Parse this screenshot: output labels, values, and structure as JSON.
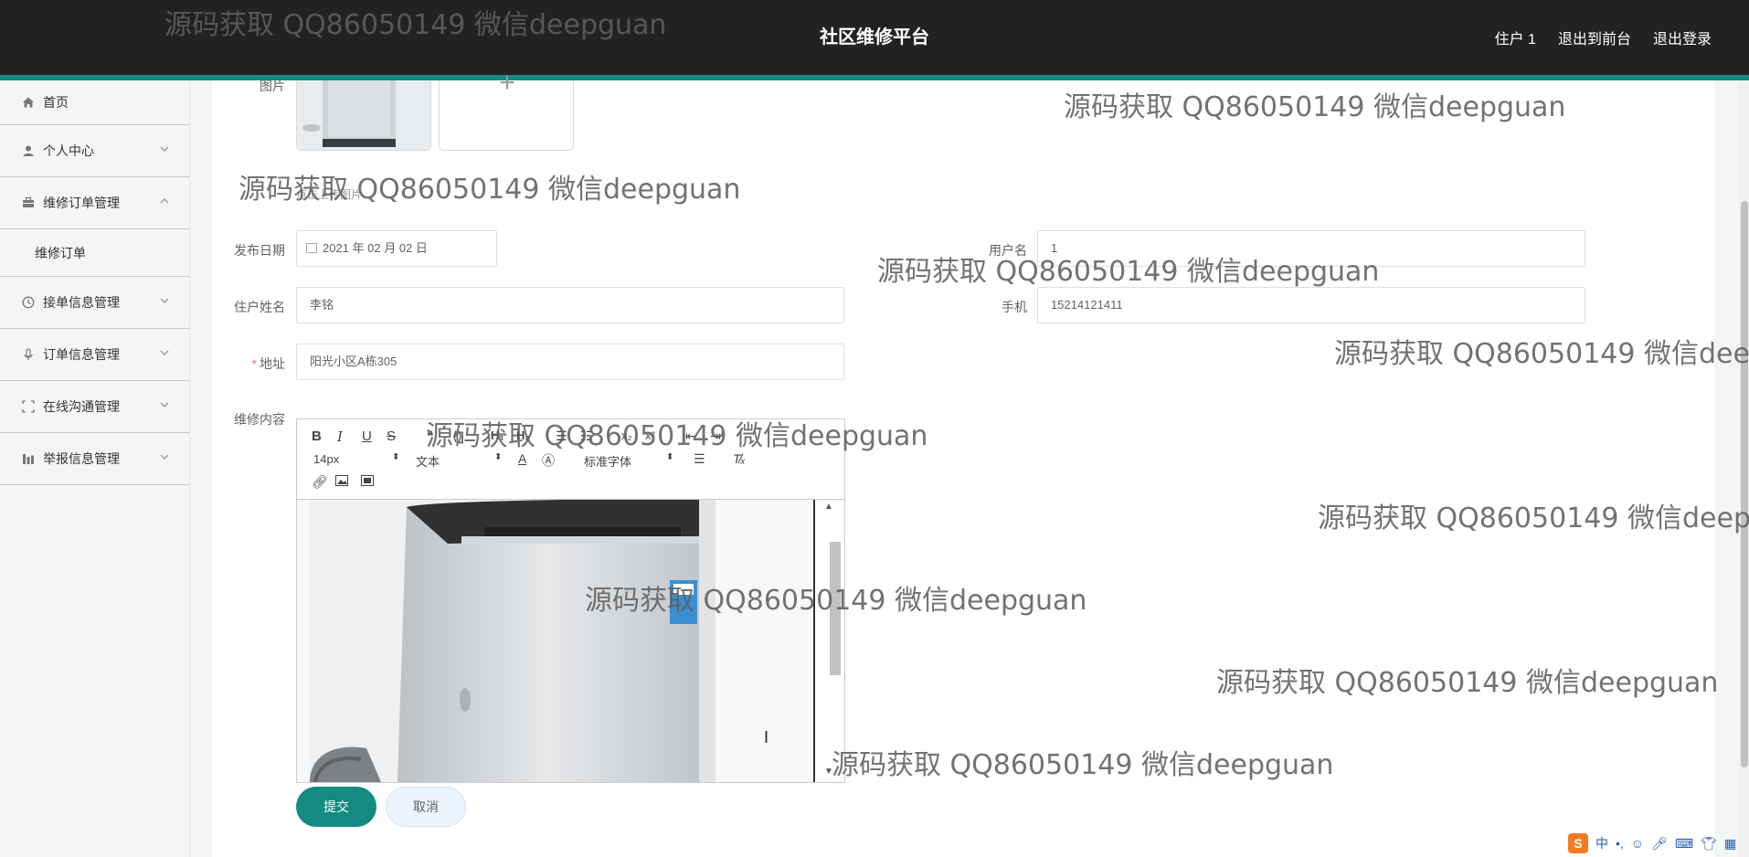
{
  "header": {
    "title": "社区维修平台",
    "user": "住户 1",
    "front_link": "退出到前台",
    "logout_link": "退出登录"
  },
  "sidebar": {
    "items": [
      {
        "label": "首页",
        "icon": "home-icon"
      },
      {
        "label": "个人中心",
        "icon": "user-icon"
      },
      {
        "label": "维修订单管理",
        "icon": "briefcase-icon"
      },
      {
        "label": "维修订单"
      },
      {
        "label": "接单信息管理",
        "icon": "clock-icon"
      },
      {
        "label": "订单信息管理",
        "icon": "microphone-icon"
      },
      {
        "label": "在线沟通管理",
        "icon": "fullscreen-icon"
      },
      {
        "label": "举报信息管理",
        "icon": "chart-icon"
      }
    ]
  },
  "form": {
    "image_label": "图片",
    "upload_tip": "点击上传图片",
    "date_label": "发布日期",
    "date_value": "2021 年 02 月 02 日",
    "username_label": "用户名",
    "username_value": "1",
    "resident_label": "住户姓名",
    "resident_value": "李铭",
    "phone_label": "手机",
    "phone_value": "15214121411",
    "address_label": "地址",
    "address_required": "*",
    "address_value": "阳光小区A栋305",
    "content_label": "维修内容"
  },
  "editor": {
    "font_size": "14px",
    "block_format": "文本",
    "font_family": "标准字体"
  },
  "buttons": {
    "submit": "提交",
    "cancel": "取消"
  },
  "watermark": "源码获取 QQ86050149 微信deepguan",
  "tray": {
    "ime_logo": "S",
    "ime_mode": "中"
  },
  "colors": {
    "accent": "#138a82",
    "topbar": "#222222",
    "required": "#f56c6c"
  }
}
